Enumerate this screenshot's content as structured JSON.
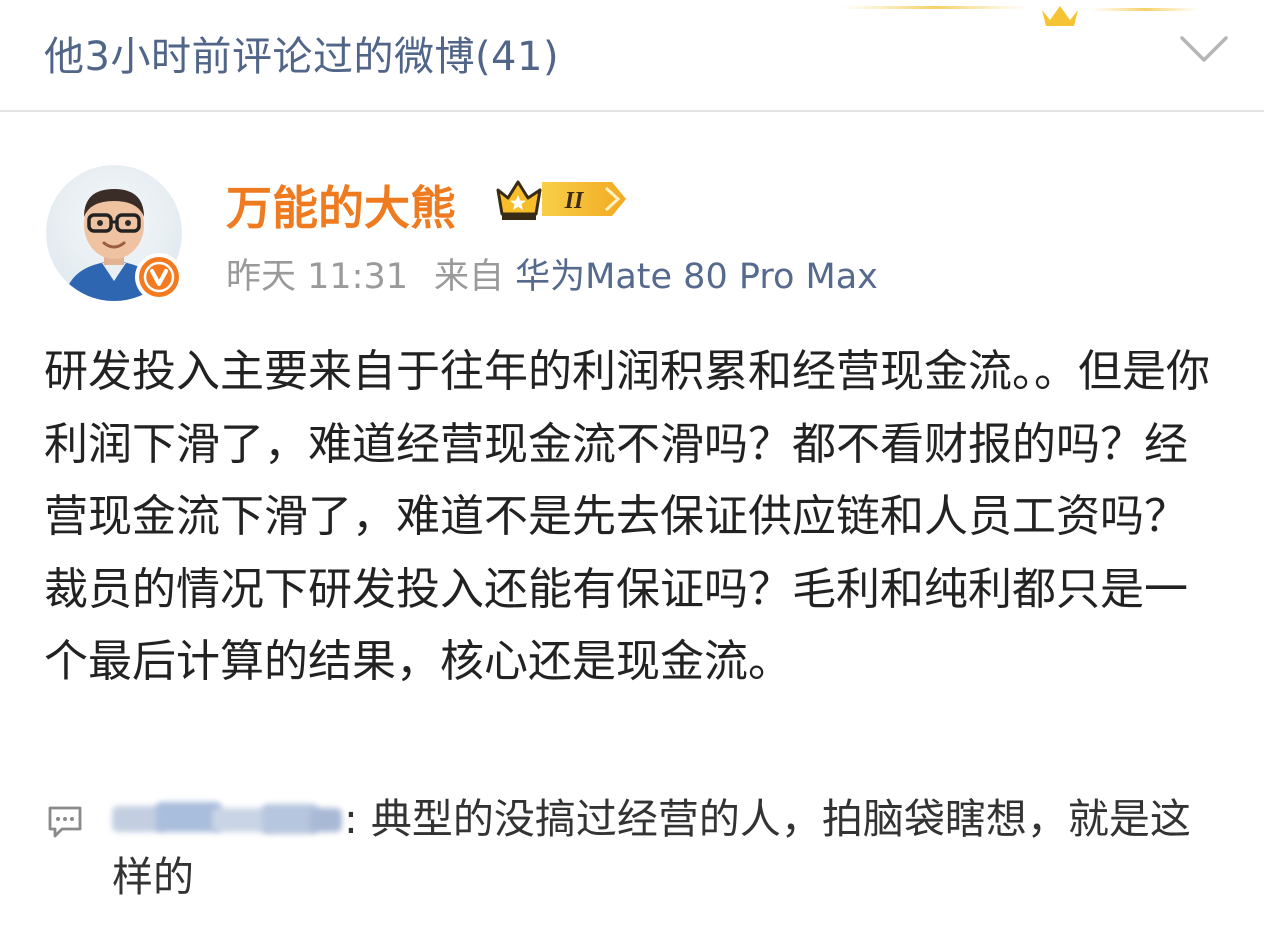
{
  "header": {
    "title": "他3小时前评论过的微博(41)",
    "collapse_icon": "chevron-down-icon"
  },
  "post": {
    "author": {
      "name": "万能的大熊",
      "verified_icon": "verified-v-icon",
      "member_badge": {
        "icon": "crown-icon",
        "level": "II"
      }
    },
    "meta": {
      "time": "昨天 11:31",
      "source_prefix": "来自",
      "device": "华为Mate 80 Pro Max"
    },
    "content": "研发投入主要来自于往年的利润积累和经营现金流。。但是你利润下滑了，难道经营现金流不滑吗？都不看财报的吗？经营现金流下滑了，难道不是先去保证供应链和人员工资吗？裁员的情况下研发投入还能有保证吗？毛利和纯利都只是一个最后计算的结果，核心还是现金流。"
  },
  "comment": {
    "icon": "comment-icon",
    "text": ": 典型的没搞过经营的人，拍脑袋瞎想，就是这样的"
  },
  "colors": {
    "header_text": "#516589",
    "username": "#ef7b21",
    "device_link": "#566a8e",
    "meta_text": "#9a9a9a",
    "body_text": "#222222",
    "verified_badge": "#f47a20",
    "crown_gold": "#f5b324"
  }
}
